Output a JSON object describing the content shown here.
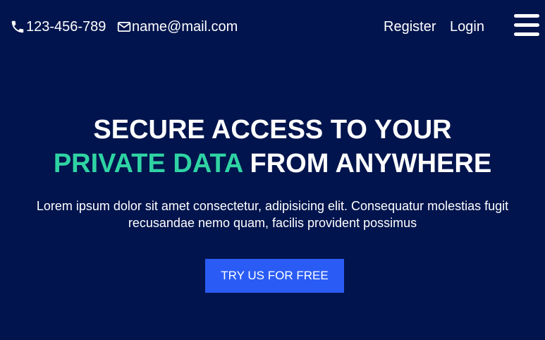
{
  "header": {
    "phone": "123-456-789",
    "email": "name@mail.com",
    "nav": {
      "register": "Register",
      "login": "Login"
    },
    "icons": {
      "phone": "phone-icon",
      "email": "envelope-icon",
      "menu": "hamburger-menu-icon"
    }
  },
  "hero": {
    "headline_line1": "SECURE ACCESS TO YOUR",
    "headline_accent": "PRIVATE DATA",
    "headline_rest": " FROM ANYWHERE",
    "description": "Lorem ipsum dolor sit amet consectetur, adipisicing elit. Consequatur molestias fugit recusandae nemo quam, facilis provident possimus",
    "cta_label": "TRY US FOR FREE"
  },
  "colors": {
    "background": "#01144d",
    "accent": "#2fd3a3",
    "button": "#2a5cf5",
    "text": "#ffffff"
  }
}
